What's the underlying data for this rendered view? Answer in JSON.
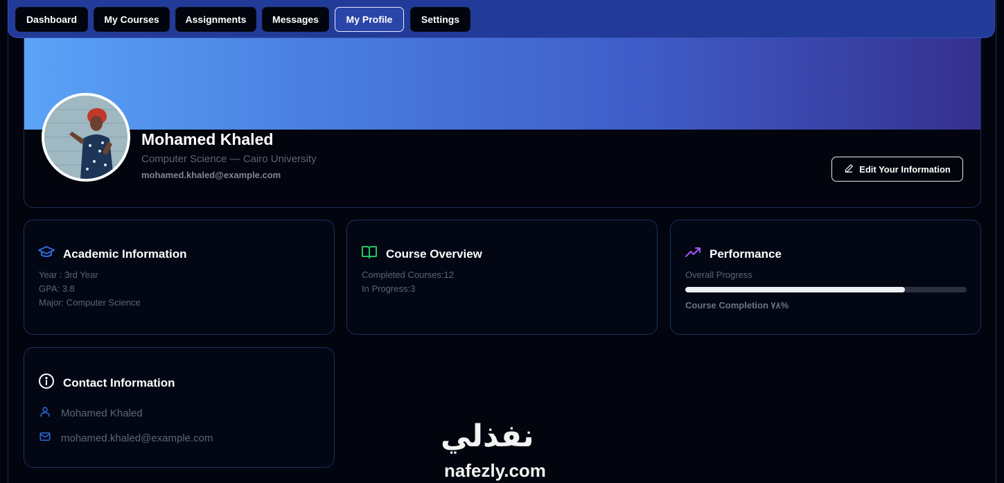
{
  "nav": {
    "items": [
      {
        "label": "Dashboard"
      },
      {
        "label": "My Courses"
      },
      {
        "label": "Assignments"
      },
      {
        "label": "Messages"
      },
      {
        "label": "My Profile",
        "active": true
      },
      {
        "label": "Settings"
      }
    ]
  },
  "profile": {
    "name": "Mohamed Khaled",
    "subtitle": "Computer Science — Cairo University",
    "email": "mohamed.khaled@example.com",
    "edit_label": "Edit Your Information"
  },
  "academic": {
    "title": "Academic Information",
    "icon": "graduation-cap-icon",
    "year": "Year : 3rd Year",
    "gpa": "GPA: 3.8",
    "major": "Major: Computer Science"
  },
  "courses": {
    "title": "Course Overview",
    "icon": "open-book-icon",
    "completed": "Completed Courses:12",
    "in_progress": "In Progress:3"
  },
  "performance": {
    "title": "Performance",
    "icon": "trending-up-icon",
    "overall_label": "Overall Progress",
    "progress_value": 0.78,
    "completion_label": "Course Completion ٧٨%"
  },
  "contact": {
    "title": "Contact Information",
    "icon": "info-icon",
    "name": "Mohamed Khaled",
    "email": "mohamed.khaled@example.com"
  },
  "watermark": {
    "arabic": "نفذلي",
    "latin": "nafezly.com"
  },
  "colors": {
    "accent_blue": "#2f6be0",
    "accent_green": "#22c55e",
    "accent_purple": "#a855f7",
    "nav_bg": "#223b98"
  }
}
